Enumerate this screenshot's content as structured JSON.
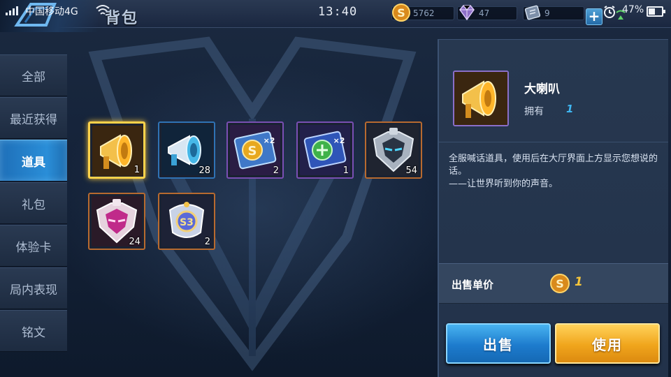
{
  "status_bar": {
    "carrier": "中国移动4G",
    "time": "13:40",
    "battery_percent": "47%",
    "battery_level": 0.47
  },
  "header": {
    "title": "背包"
  },
  "currency": {
    "gold": "5762",
    "gems": "47",
    "tickets": "9"
  },
  "sidebar": {
    "items": [
      {
        "label": "全部",
        "active": false
      },
      {
        "label": "最近获得",
        "active": false
      },
      {
        "label": "道具",
        "active": true
      },
      {
        "label": "礼包",
        "active": false
      },
      {
        "label": "体验卡",
        "active": false
      },
      {
        "label": "局内表现",
        "active": false
      },
      {
        "label": "铭文",
        "active": false
      }
    ]
  },
  "items": [
    {
      "icon": "megaphone-gold-icon",
      "count": "1",
      "selected": true,
      "rarity": "gold"
    },
    {
      "icon": "megaphone-blue-icon",
      "count": "28",
      "selected": false,
      "rarity": "blue"
    },
    {
      "icon": "gold-double-card-icon",
      "count": "2",
      "selected": false,
      "rarity": "purple"
    },
    {
      "icon": "exp-double-card-icon",
      "count": "1",
      "selected": false,
      "rarity": "purple"
    },
    {
      "icon": "helmet-fragment-icon",
      "count": "54",
      "selected": false,
      "rarity": "orange"
    },
    {
      "icon": "pink-helmet-fragment-icon",
      "count": "24",
      "selected": false,
      "rarity": "orange"
    },
    {
      "icon": "s3-badge-icon",
      "count": "2",
      "selected": false,
      "rarity": "orange"
    }
  ],
  "detail": {
    "name": "大喇叭",
    "owned_label": "拥有",
    "owned_value": "1",
    "description_line1": "全服喊话道具，使用后在大厅界面上方显示您想说的话。",
    "description_line2": "——让世界听到你的声音。",
    "price_label": "出售单价",
    "price_value": "1",
    "sell_button": "出售",
    "use_button": "使用"
  },
  "colors": {
    "accent_blue": "#2a8ed8",
    "gold": "#f6c53a",
    "owned_value": "#3fb7f2"
  }
}
